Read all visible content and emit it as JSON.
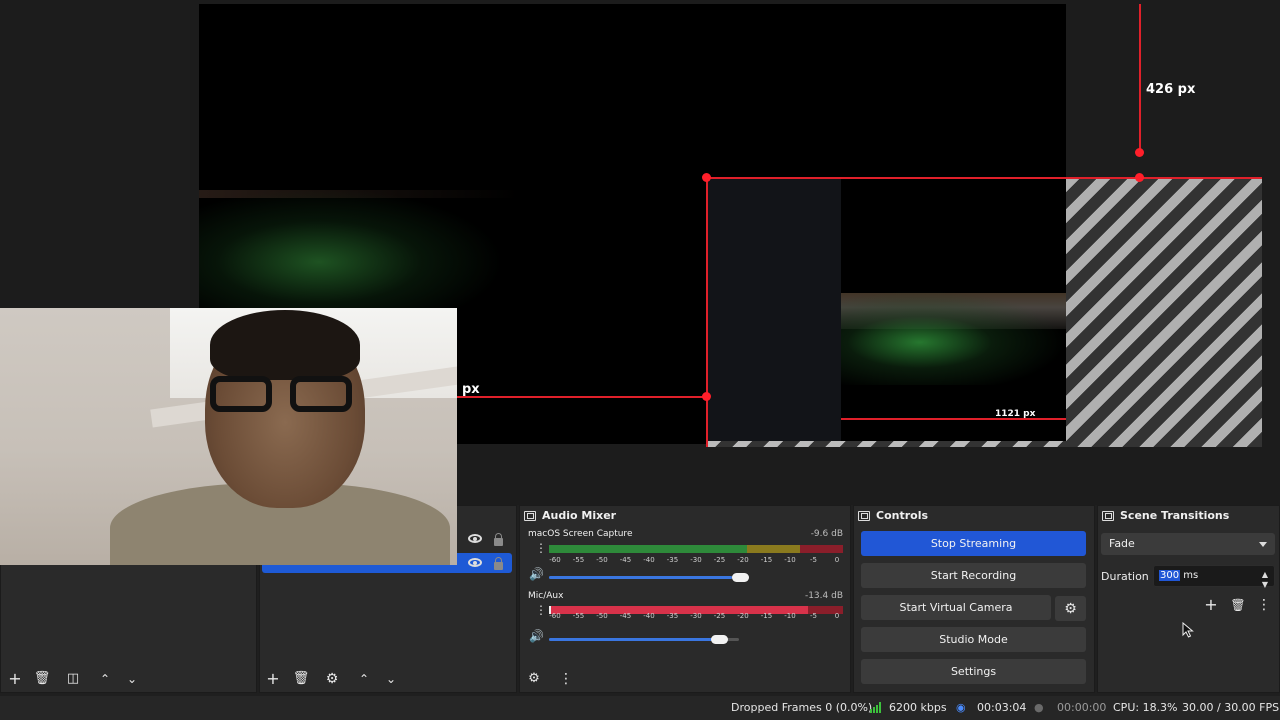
{
  "preview": {
    "measure_vertical": "426 px",
    "measure_left": "px",
    "measure_inner": "1121 px"
  },
  "audio_mixer": {
    "title": "Audio Mixer",
    "channels": [
      {
        "name": "macOS Screen Capture",
        "db": "-9.6 dB",
        "volume": 0.88
      },
      {
        "name": "Mic/Aux",
        "db": "-13.4 dB",
        "volume": 0.79
      }
    ],
    "scale": [
      "-60",
      "-55",
      "-50",
      "-45",
      "-40",
      "-35",
      "-30",
      "-25",
      "-20",
      "-15",
      "-10",
      "-5",
      "0"
    ]
  },
  "controls": {
    "title": "Controls",
    "buttons": [
      "Stop Streaming",
      "Start Recording",
      "Start Virtual Camera",
      "Studio Mode",
      "Settings"
    ]
  },
  "transitions": {
    "title": "Scene Transitions",
    "selected": "Fade",
    "duration_label": "Duration",
    "duration_value": "300",
    "duration_unit": " ms"
  },
  "status": {
    "dropped_frames": "Dropped Frames 0 (0.0%)",
    "bitrate": "6200 kbps",
    "stream_time": "00:03:04",
    "record_time": "00:00:00",
    "cpu": "CPU: 18.3%",
    "fps": "30.00 / 30.00 FPS"
  },
  "colors": {
    "accent": "#2157d6",
    "measure": "#e0202a"
  }
}
